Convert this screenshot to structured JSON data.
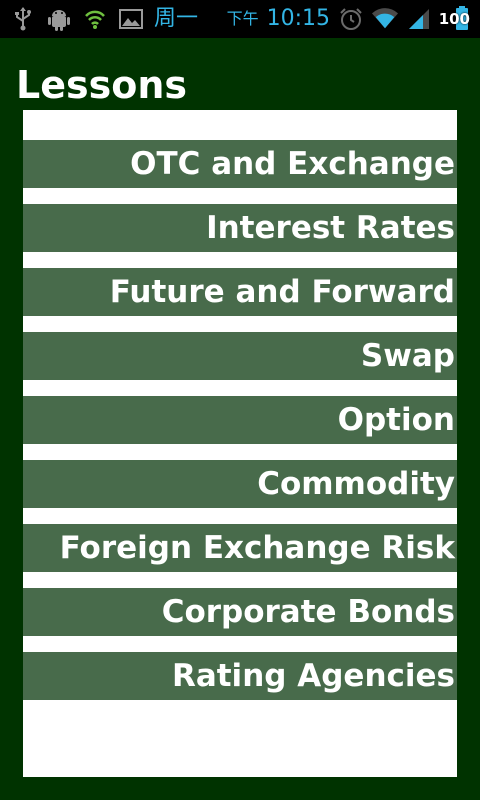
{
  "status_bar": {
    "day": "周一",
    "ampm": "下午",
    "time": "10:15",
    "battery": "100",
    "icons": [
      "usb-icon",
      "android-debug-icon",
      "wifi-hotspot-icon",
      "picture-icon",
      "alarm-icon",
      "wifi-icon",
      "signal-icon",
      "battery-icon"
    ]
  },
  "header": {
    "title": "Lessons"
  },
  "lessons": [
    {
      "label": "OTC and Exchange"
    },
    {
      "label": "Interest Rates"
    },
    {
      "label": "Future and Forward"
    },
    {
      "label": "Swap"
    },
    {
      "label": "Option"
    },
    {
      "label": "Commodity"
    },
    {
      "label": "Foreign Exchange Risk"
    },
    {
      "label": "Corporate Bonds"
    },
    {
      "label": "Rating Agencies"
    }
  ],
  "colors": {
    "background": "#003300",
    "item": "#486b4b",
    "panel": "#ffffff",
    "status_accent": "#33b5e5"
  }
}
